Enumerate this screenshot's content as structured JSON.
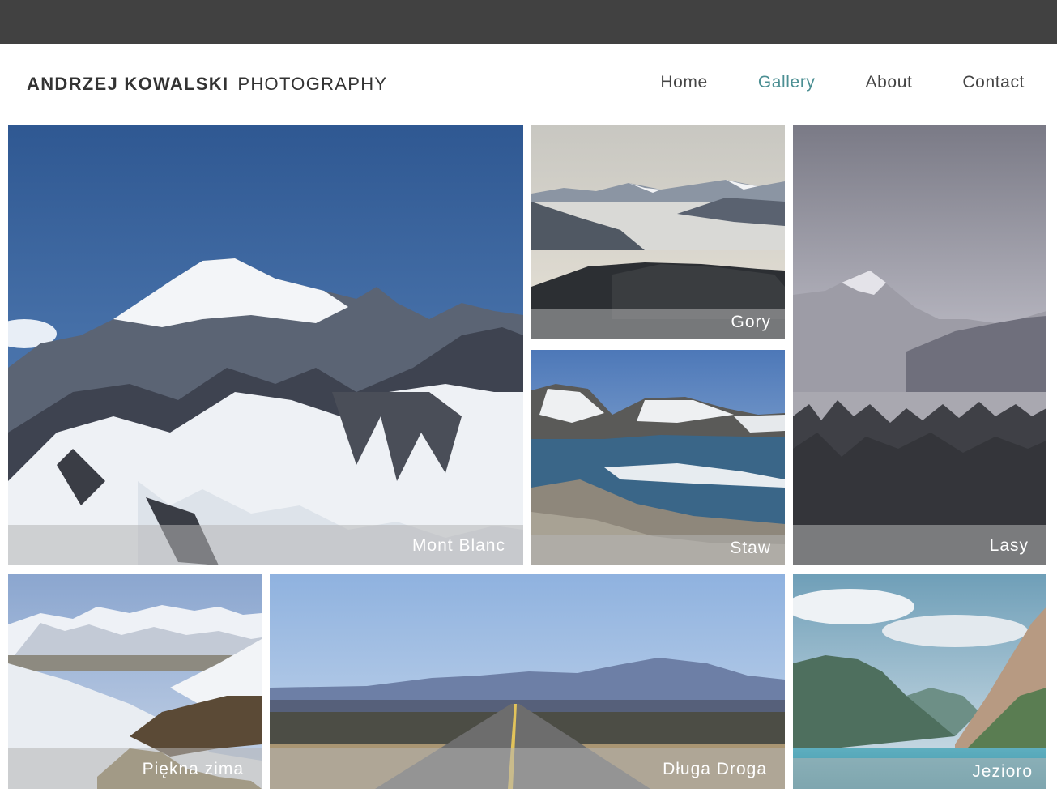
{
  "brand": {
    "name": "ANDRZEJ KOWALSKI",
    "subtitle": "PHOTOGRAPHY"
  },
  "nav": {
    "items": [
      {
        "label": "Home",
        "active": false
      },
      {
        "label": "Gallery",
        "active": true
      },
      {
        "label": "About",
        "active": false
      },
      {
        "label": "Contact",
        "active": false
      }
    ]
  },
  "colors": {
    "topbar": "#414141",
    "accent": "#4c8f93",
    "text": "#333333"
  },
  "gallery": {
    "photos": [
      {
        "caption": "Mont Blanc"
      },
      {
        "caption": "Gory"
      },
      {
        "caption": "Staw"
      },
      {
        "caption": "Lasy"
      },
      {
        "caption": "Piękna zima"
      },
      {
        "caption": "Długa Droga"
      },
      {
        "caption": "Jezioro"
      }
    ]
  }
}
